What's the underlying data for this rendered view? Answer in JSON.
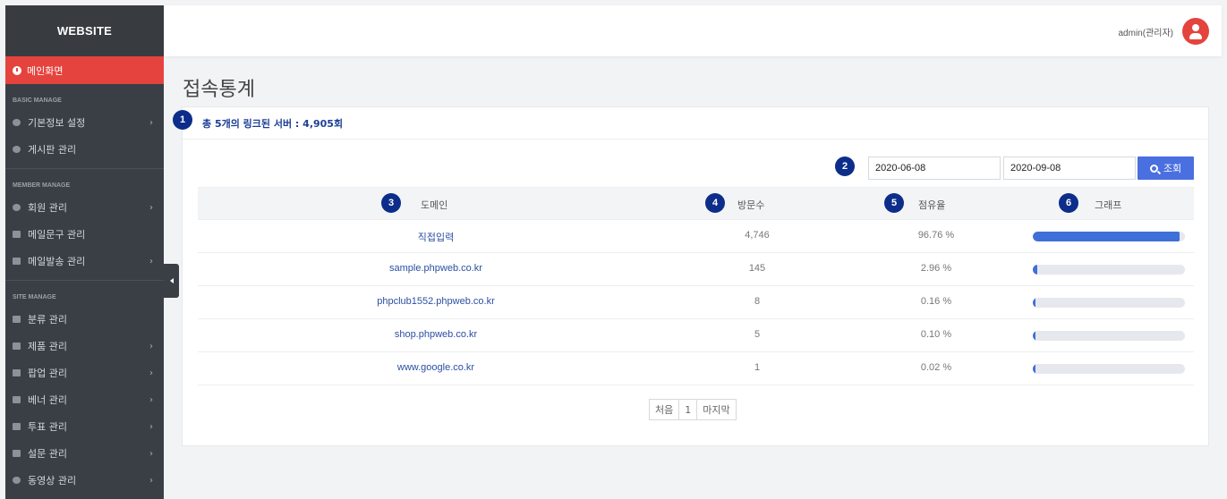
{
  "sidebar": {
    "brand": "WEBSITE",
    "main_item": "메인화면",
    "sections": [
      {
        "title": "BASIC MANAGE",
        "items": [
          {
            "label": "기본정보 설정",
            "icon": "gear-icon",
            "chevron": "›"
          },
          {
            "label": "게시판 관리",
            "icon": "comments-icon"
          }
        ]
      },
      {
        "title": "MEMBER MANAGE",
        "items": [
          {
            "label": "회원 관리",
            "icon": "user-icon",
            "chevron": "›"
          },
          {
            "label": "메일문구 관리",
            "icon": "spellcheck-icon"
          },
          {
            "label": "메일발송 관리",
            "icon": "envelope-icon",
            "chevron": "›"
          }
        ]
      },
      {
        "title": "SITE MANAGE",
        "items": [
          {
            "label": "분류 관리",
            "icon": "list-icon"
          },
          {
            "label": "제품 관리",
            "icon": "box-icon",
            "chevron": "›"
          },
          {
            "label": "팝업 관리",
            "icon": "window-icon",
            "chevron": "›"
          },
          {
            "label": "베너 관리",
            "icon": "banner-icon",
            "chevron": "›"
          },
          {
            "label": "투표 관리",
            "icon": "chart-icon",
            "chevron": "›"
          },
          {
            "label": "설문 관리",
            "icon": "survey-icon",
            "chevron": "›"
          },
          {
            "label": "동영상 관리",
            "icon": "play-icon",
            "chevron": "›"
          }
        ]
      }
    ]
  },
  "header": {
    "user_label": "admin(관리자)"
  },
  "page": {
    "title": "접속통계"
  },
  "summary": "총 5개의 링크된 서버 : 4,905회",
  "filter": {
    "start_date": "2020-06-08",
    "end_date": "2020-09-08",
    "search_label": "조회"
  },
  "badges": [
    "1",
    "2",
    "3",
    "4",
    "5",
    "6"
  ],
  "table": {
    "columns": [
      "도메인",
      "방문수",
      "점유율",
      "그래프"
    ],
    "rows": [
      {
        "domain": "직접입력",
        "visits": "4,746",
        "share": "96.76 %",
        "pct": 96.76
      },
      {
        "domain": "sample.phpweb.co.kr",
        "visits": "145",
        "share": "2.96 %",
        "pct": 2.96
      },
      {
        "domain": "phpclub1552.phpweb.co.kr",
        "visits": "8",
        "share": "0.16 %",
        "pct": 0.16
      },
      {
        "domain": "shop.phpweb.co.kr",
        "visits": "5",
        "share": "0.10 %",
        "pct": 0.1
      },
      {
        "domain": "www.google.co.kr",
        "visits": "1",
        "share": "0.02 %",
        "pct": 0.02
      }
    ]
  },
  "pagination": {
    "first": "처음",
    "current": "1",
    "last": "마지막"
  }
}
